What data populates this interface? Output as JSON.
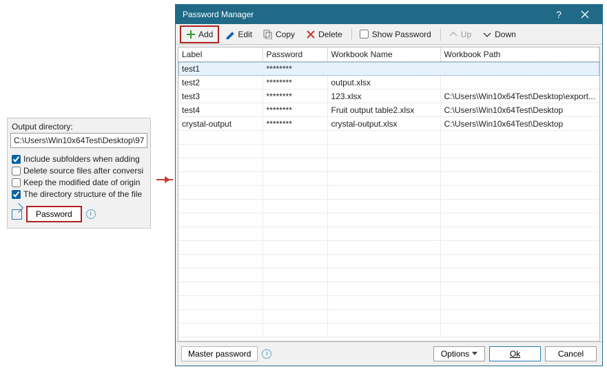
{
  "left_panel": {
    "title": "Output directory:",
    "dir_value": "C:\\Users\\Win10x64Test\\Desktop\\97",
    "checks": [
      {
        "label": "Include subfolders when adding",
        "checked": true
      },
      {
        "label": "Delete source files after conversi",
        "checked": false
      },
      {
        "label": "Keep the modified date of origin",
        "checked": false
      },
      {
        "label": "The directory structure of the file",
        "checked": true
      }
    ],
    "password_btn": "Password"
  },
  "dialog": {
    "title": "Password Manager",
    "toolbar": {
      "add": "Add",
      "edit": "Edit",
      "copy": "Copy",
      "delete": "Delete",
      "show_password": "Show Password",
      "up": "Up",
      "down": "Down"
    },
    "columns": [
      "Label",
      "Password",
      "Workbook Name",
      "Workbook Path"
    ],
    "rows": [
      {
        "label": "test1",
        "pw": "********",
        "wb": "",
        "path": ""
      },
      {
        "label": "test2",
        "pw": "********",
        "wb": "output.xlsx",
        "path": ""
      },
      {
        "label": "test3",
        "pw": "********",
        "wb": "123.xlsx",
        "path": "C:\\Users\\Win10x64Test\\Desktop\\export..."
      },
      {
        "label": "test4",
        "pw": "********",
        "wb": "Fruit output table2.xlsx",
        "path": "C:\\Users\\Win10x64Test\\Desktop"
      },
      {
        "label": "crystal-output",
        "pw": "********",
        "wb": "crystal-output.xlsx",
        "path": "C:\\Users\\Win10x64Test\\Desktop"
      }
    ],
    "bottom": {
      "master_pw": "Master password",
      "options": "Options",
      "ok": "Ok",
      "cancel": "Cancel"
    }
  }
}
